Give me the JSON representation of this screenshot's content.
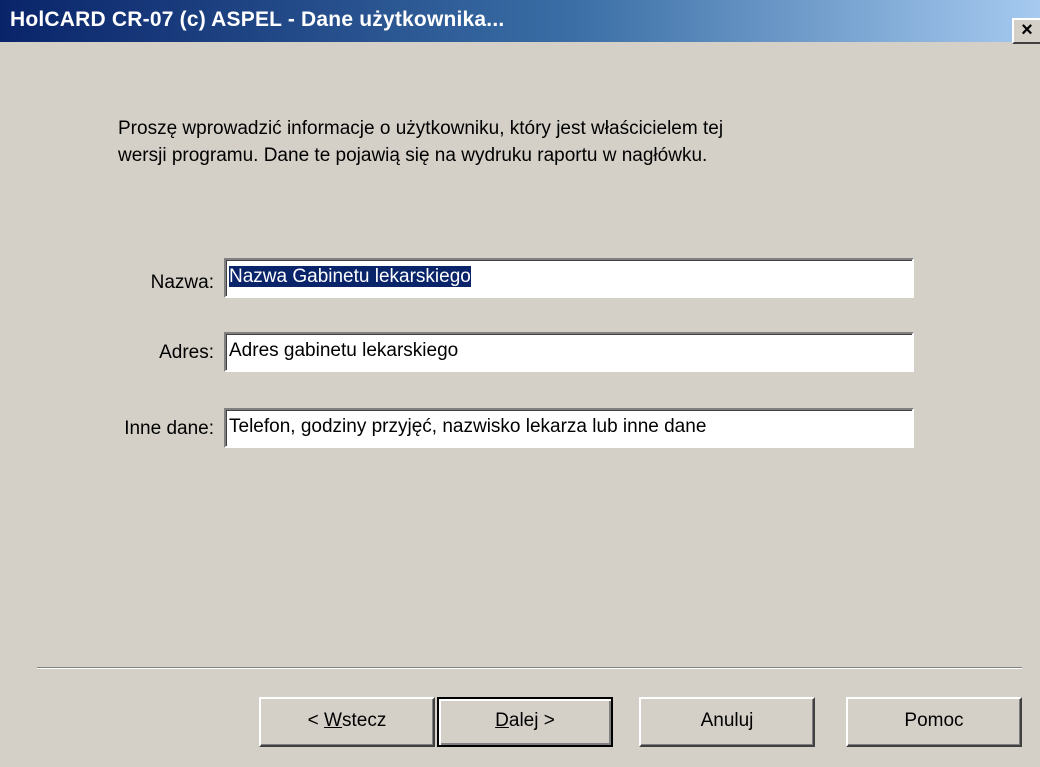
{
  "window": {
    "title": "HolCARD CR-07 (c) ASPEL - Dane użytkownika...",
    "close_glyph": "×"
  },
  "intro": {
    "line1": "Proszę wprowadzić informacje o użytkowniku, który jest właścicielem tej",
    "line2": "wersji programu. Dane te pojawią się na wydruku raportu w nagłówku."
  },
  "fields": {
    "nazwa": {
      "label": "Nazwa:",
      "value": "Nazwa Gabinetu lekarskiego"
    },
    "adres": {
      "label": "Adres:",
      "value": "Adres gabinetu lekarskiego"
    },
    "inne": {
      "label": "Inne dane:",
      "value": "Telefon, godziny przyjęć, nazwisko lekarza lub inne dane"
    }
  },
  "buttons": {
    "back": {
      "prefix": "< ",
      "mnemonic": "W",
      "rest": "stecz"
    },
    "next": {
      "mnemonic": "D",
      "rest": "alej",
      "suffix": " >"
    },
    "cancel": "Anuluj",
    "help": "Pomoc"
  },
  "colors": {
    "titlebar_start": "#0a246a",
    "titlebar_end": "#a6caf0",
    "dialog_bg": "#d4d0c8",
    "selection": "#0a246a"
  }
}
